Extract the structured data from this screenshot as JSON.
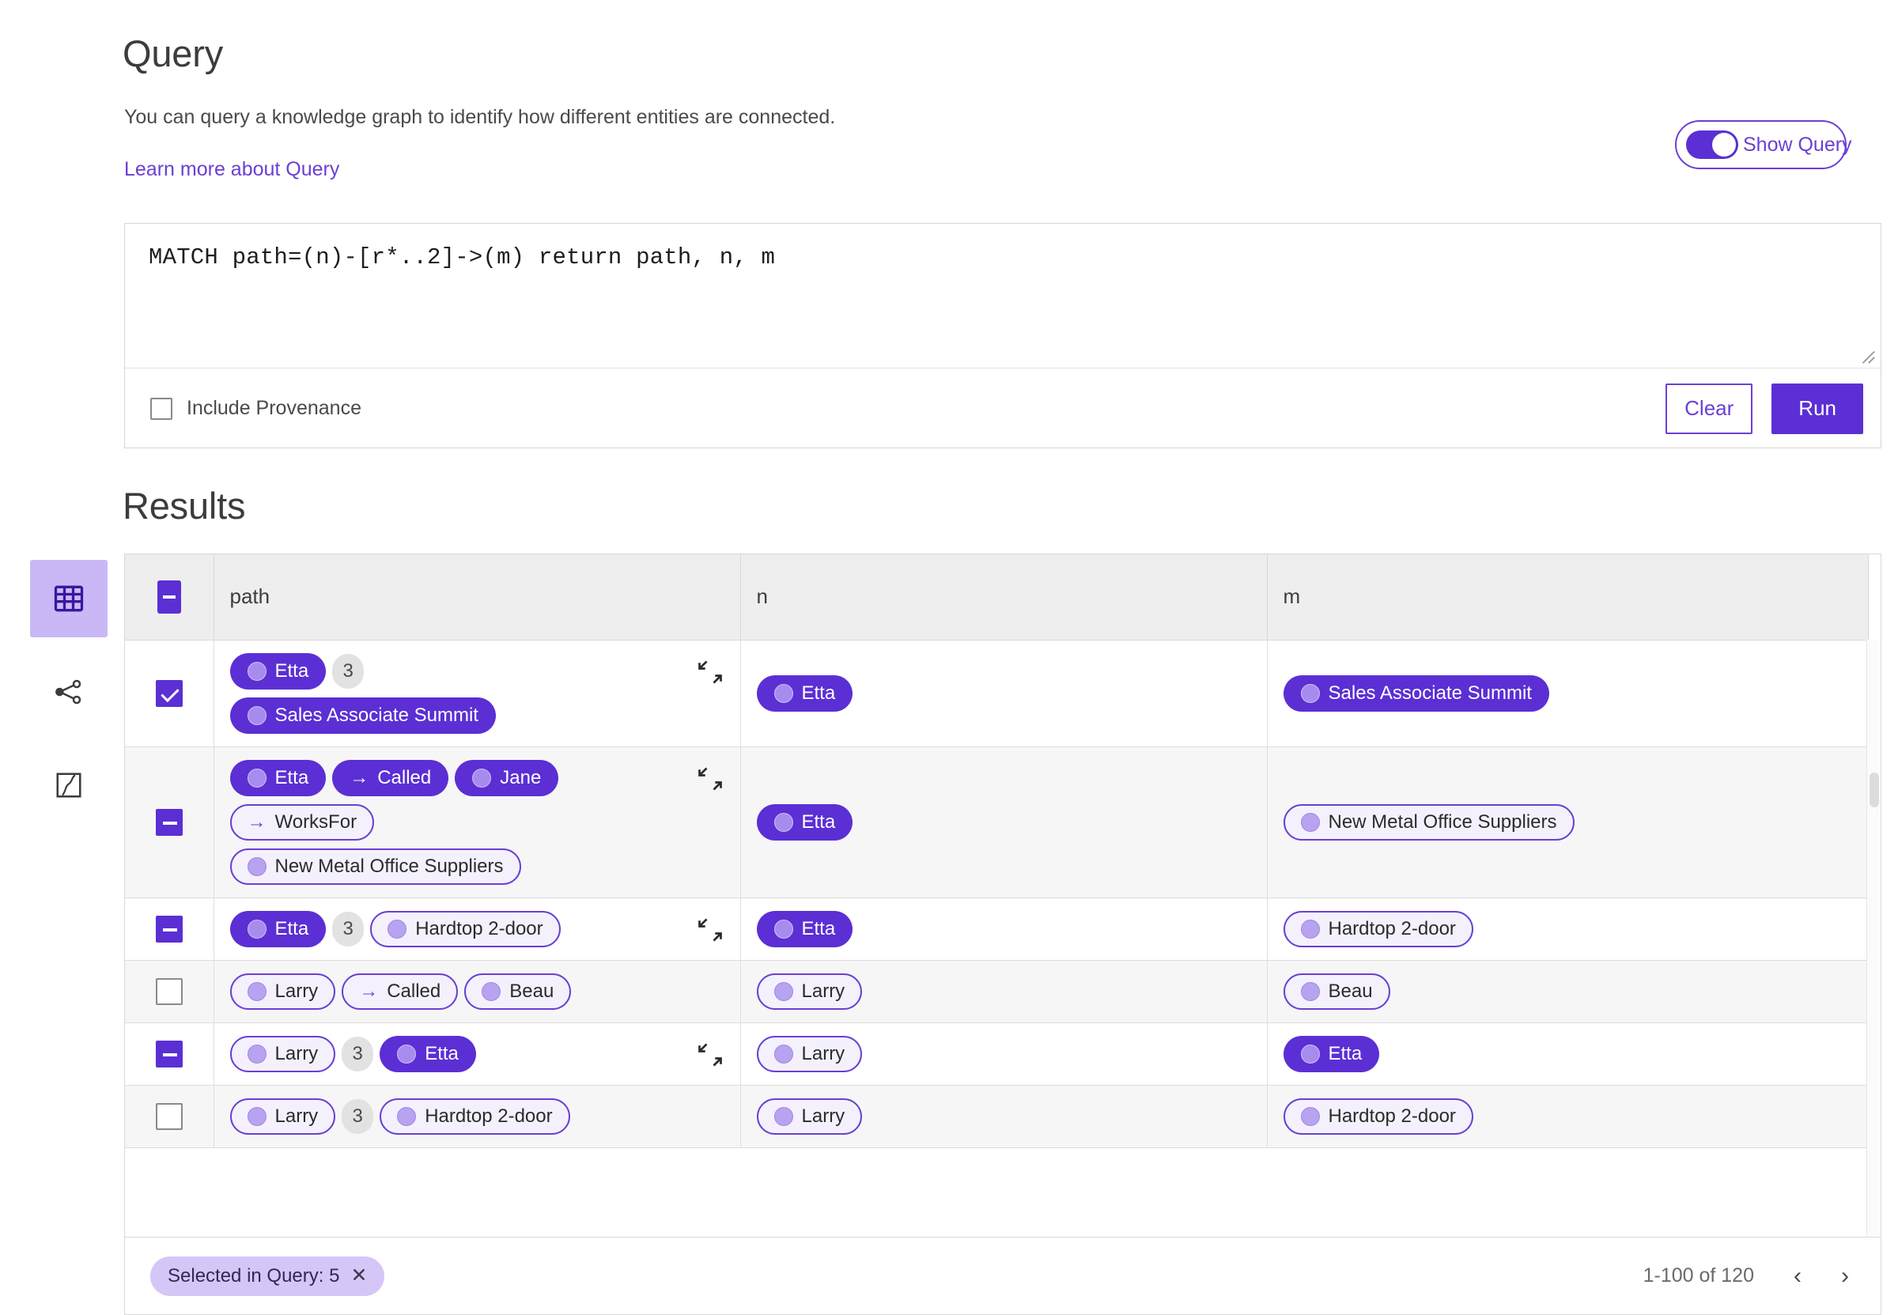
{
  "header": {
    "title": "Query",
    "description": "You can query a knowledge graph to identify how different entities are connected.",
    "learn_more": "Learn more about Query",
    "show_query_label": "Show Query",
    "show_query_on": true
  },
  "query_editor": {
    "text": "MATCH path=(n)-[r*..2]->(m) return path, n, m",
    "include_provenance_label": "Include Provenance",
    "include_provenance_checked": false,
    "clear_label": "Clear",
    "run_label": "Run"
  },
  "results": {
    "title": "Results",
    "columns": [
      "path",
      "n",
      "m"
    ],
    "header_select_state": "indeterminate",
    "rows": [
      {
        "select": "checked",
        "path_lines": [
          [
            {
              "kind": "node",
              "label": "Etta",
              "style": "solid"
            },
            {
              "kind": "badge",
              "label": "3"
            }
          ],
          [
            {
              "kind": "node",
              "label": "Sales Associate Summit",
              "style": "solid"
            }
          ]
        ],
        "n": [
          {
            "kind": "node",
            "label": "Etta",
            "style": "solid"
          }
        ],
        "m": [
          {
            "kind": "node",
            "label": "Sales Associate Summit",
            "style": "solid"
          }
        ],
        "expandable": true,
        "alt": false
      },
      {
        "select": "indeterminate",
        "path_lines": [
          [
            {
              "kind": "node",
              "label": "Etta",
              "style": "solid"
            },
            {
              "kind": "rel",
              "label": "Called",
              "style": "solid"
            },
            {
              "kind": "node",
              "label": "Jane",
              "style": "solid"
            }
          ],
          [
            {
              "kind": "rel",
              "label": "WorksFor",
              "style": "outline"
            }
          ],
          [
            {
              "kind": "node",
              "label": "New Metal Office Suppliers",
              "style": "outline"
            }
          ]
        ],
        "n": [
          {
            "kind": "node",
            "label": "Etta",
            "style": "solid"
          }
        ],
        "m": [
          {
            "kind": "node",
            "label": "New Metal Office Suppliers",
            "style": "outline"
          }
        ],
        "expandable": true,
        "alt": true
      },
      {
        "select": "indeterminate",
        "path_lines": [
          [
            {
              "kind": "node",
              "label": "Etta",
              "style": "solid"
            },
            {
              "kind": "badge",
              "label": "3"
            },
            {
              "kind": "node",
              "label": "Hardtop 2-door",
              "style": "outline"
            }
          ]
        ],
        "n": [
          {
            "kind": "node",
            "label": "Etta",
            "style": "solid"
          }
        ],
        "m": [
          {
            "kind": "node",
            "label": "Hardtop 2-door",
            "style": "outline"
          }
        ],
        "expandable": true,
        "alt": false
      },
      {
        "select": "unchecked",
        "path_lines": [
          [
            {
              "kind": "node",
              "label": "Larry",
              "style": "outline"
            },
            {
              "kind": "rel",
              "label": "Called",
              "style": "outline"
            },
            {
              "kind": "node",
              "label": "Beau",
              "style": "outline"
            }
          ]
        ],
        "n": [
          {
            "kind": "node",
            "label": "Larry",
            "style": "outline"
          }
        ],
        "m": [
          {
            "kind": "node",
            "label": "Beau",
            "style": "outline"
          }
        ],
        "expandable": false,
        "alt": true
      },
      {
        "select": "indeterminate",
        "path_lines": [
          [
            {
              "kind": "node",
              "label": "Larry",
              "style": "outline"
            },
            {
              "kind": "badge",
              "label": "3"
            },
            {
              "kind": "node",
              "label": "Etta",
              "style": "solid"
            }
          ]
        ],
        "n": [
          {
            "kind": "node",
            "label": "Larry",
            "style": "outline"
          }
        ],
        "m": [
          {
            "kind": "node",
            "label": "Etta",
            "style": "solid"
          }
        ],
        "expandable": true,
        "alt": false
      },
      {
        "select": "unchecked",
        "path_lines": [
          [
            {
              "kind": "node",
              "label": "Larry",
              "style": "outline"
            },
            {
              "kind": "badge",
              "label": "3"
            },
            {
              "kind": "node",
              "label": "Hardtop 2-door",
              "style": "outline"
            }
          ]
        ],
        "n": [
          {
            "kind": "node",
            "label": "Larry",
            "style": "outline"
          }
        ],
        "m": [
          {
            "kind": "node",
            "label": "Hardtop 2-door",
            "style": "outline"
          }
        ],
        "expandable": false,
        "alt": true
      }
    ]
  },
  "footer": {
    "selected_chip": "Selected in Query: 5",
    "selected_chip_close": "✕",
    "pagination": "1-100 of 120",
    "prev": "‹",
    "next": "›"
  },
  "sidebar": {
    "items": [
      {
        "name": "table-view",
        "active": true
      },
      {
        "name": "graph-view",
        "active": false
      },
      {
        "name": "map-view",
        "active": false
      }
    ]
  },
  "colors": {
    "accent": "#5b2fd4",
    "accent_border": "#6b3fd4",
    "pill_outline_bg": "#f4f1fd",
    "rail_active_bg": "#c9b8f5",
    "chip_bg": "#d5c6f8",
    "header_bg": "#eeeeee",
    "alt_row_bg": "#f6f6f6"
  }
}
